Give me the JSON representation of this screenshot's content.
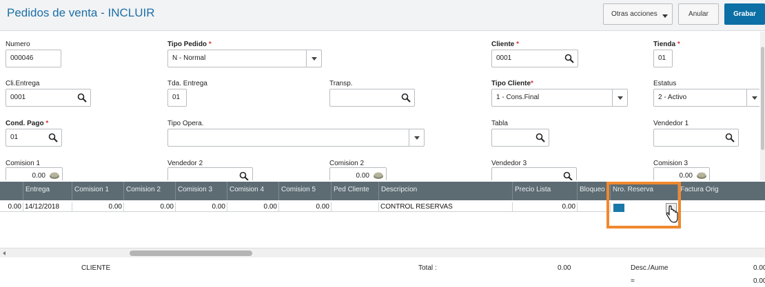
{
  "header": {
    "title": "Pedidos de venta - INCLUIR",
    "otras_acciones": "Otras acciones",
    "anular": "Anular",
    "grabar": "Grabar",
    "accent_color": "#0c6fa5"
  },
  "form": {
    "numero": {
      "label": "Numero",
      "value": "000046"
    },
    "tipo_pedido": {
      "label": "Tipo Pedido",
      "required": "*",
      "value": "N - Normal"
    },
    "cliente": {
      "label": "Cliente",
      "required": "*",
      "value": "0001"
    },
    "tienda": {
      "label": "Tienda",
      "required": "*",
      "value": "01"
    },
    "cli_entrega": {
      "label": "Cli.Entrega",
      "value": "0001"
    },
    "tda_entrega": {
      "label": "Tda. Entrega",
      "value": "01"
    },
    "transp": {
      "label": "Transp.",
      "value": ""
    },
    "tipo_cliente": {
      "label": "Tipo Cliente",
      "required": "*",
      "value": "1 - Cons.Final"
    },
    "estatus": {
      "label": "Estatus",
      "value": "2 - Activo"
    },
    "cond_pago": {
      "label": "Cond. Pago",
      "required": "*",
      "value": "01"
    },
    "tipo_opera": {
      "label": "Tipo Opera.",
      "value": ""
    },
    "tabla": {
      "label": "Tabla",
      "value": ""
    },
    "vendedor1": {
      "label": "Vendedor 1",
      "value": ""
    },
    "comision1": {
      "label": "Comision 1",
      "value": "0.00"
    },
    "vendedor2": {
      "label": "Vendedor 2",
      "value": ""
    },
    "comision2": {
      "label": "Comision 2",
      "value": "0.00"
    },
    "vendedor3": {
      "label": "Vendedor 3",
      "value": ""
    },
    "comision3": {
      "label": "Comision 3",
      "value": "0.00"
    }
  },
  "grid": {
    "columns": [
      "Entrega",
      "Comision 1",
      "Comision 2",
      "Comision 3",
      "Comision 4",
      "Comision 5",
      "Ped Cliente",
      "Descripcion",
      "Precio Lista",
      "Bloqueo",
      "Nro. Reserva",
      "Factura Orig"
    ],
    "row": {
      "c0": "0.00",
      "entrega": "14/12/2018",
      "com1": "0.00",
      "com2": "0.00",
      "com3": "0.00",
      "com4": "0.00",
      "com5": "0.00",
      "ped_cliente": "",
      "descripcion": "CONTROL RESERVAS",
      "precio_lista": "0.00",
      "bloqueo": "",
      "nro_reserva": "",
      "factura_orig": ""
    },
    "header_color": "#5d6c73",
    "highlight_color": "#f0882e"
  },
  "footer": {
    "cliente_label": "CLIENTE",
    "total_label": "Total :",
    "total_value": "0.00",
    "desc_label": "Desc./Aume",
    "desc_value": "0.00",
    "eq_label": "=",
    "eq_value": "0.00"
  }
}
